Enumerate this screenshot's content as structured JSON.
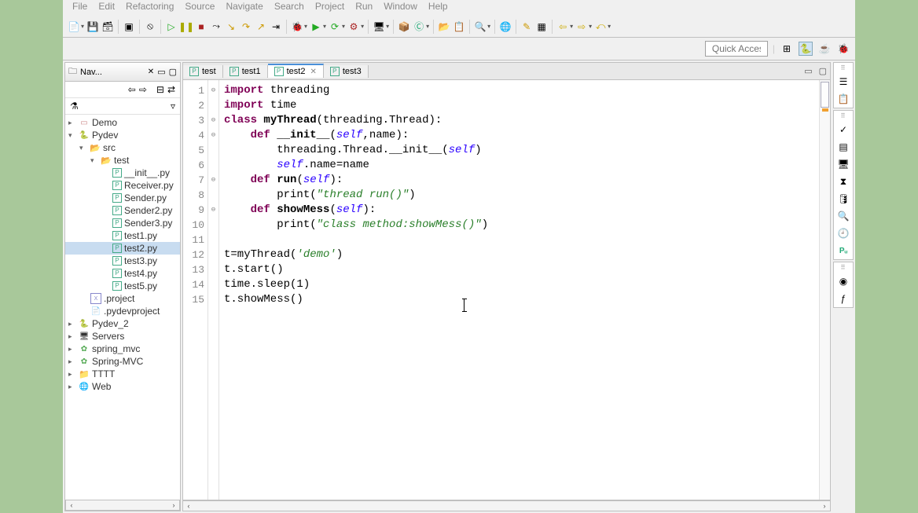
{
  "menu": [
    "File",
    "Edit",
    "Refactoring",
    "Source",
    "Navigate",
    "Search",
    "Project",
    "Run",
    "Window",
    "Help"
  ],
  "quick_access": {
    "placeholder": "Quick Access"
  },
  "nav": {
    "title": "Nav...",
    "tree": {
      "projects": [
        {
          "name": "Demo",
          "icon": "java-proj"
        },
        {
          "name": "Pydev",
          "icon": "py-proj",
          "expanded": true,
          "children": [
            {
              "name": "src",
              "icon": "folder-open",
              "expanded": true,
              "children": [
                {
                  "name": "test",
                  "icon": "folder-open",
                  "expanded": true,
                  "children": [
                    {
                      "name": "__init__.py",
                      "icon": "py"
                    },
                    {
                      "name": "Receiver.py",
                      "icon": "py"
                    },
                    {
                      "name": "Sender.py",
                      "icon": "py"
                    },
                    {
                      "name": "Sender2.py",
                      "icon": "py"
                    },
                    {
                      "name": "Sender3.py",
                      "icon": "py"
                    },
                    {
                      "name": "test1.py",
                      "icon": "py"
                    },
                    {
                      "name": "test2.py",
                      "icon": "py",
                      "selected": true
                    },
                    {
                      "name": "test3.py",
                      "icon": "py"
                    },
                    {
                      "name": "test4.py",
                      "icon": "py"
                    },
                    {
                      "name": "test5.py",
                      "icon": "py"
                    }
                  ]
                }
              ]
            },
            {
              "name": ".project",
              "icon": "xml"
            },
            {
              "name": ".pydevproject",
              "icon": "file"
            }
          ]
        },
        {
          "name": "Pydev_2",
          "icon": "py-proj"
        },
        {
          "name": "Servers",
          "icon": "server-proj"
        },
        {
          "name": "spring_mvc",
          "icon": "spring-proj"
        },
        {
          "name": "Spring-MVC",
          "icon": "spring-proj"
        },
        {
          "name": "TTTT",
          "icon": "folder"
        },
        {
          "name": "Web",
          "icon": "web-proj"
        }
      ]
    }
  },
  "editor": {
    "tabs": [
      {
        "label": "test",
        "icon": "py",
        "active": false
      },
      {
        "label": "test1",
        "icon": "py",
        "active": false
      },
      {
        "label": "test2",
        "icon": "py",
        "active": true
      },
      {
        "label": "test3",
        "icon": "py",
        "active": false
      }
    ],
    "code_lines": [
      {
        "n": 1,
        "fold": "⊖",
        "tokens": [
          {
            "t": "import ",
            "c": "kw"
          },
          {
            "t": "threading"
          }
        ]
      },
      {
        "n": 2,
        "fold": "",
        "tokens": [
          {
            "t": "import ",
            "c": "kw"
          },
          {
            "t": "time"
          }
        ]
      },
      {
        "n": 3,
        "fold": "⊖",
        "tokens": [
          {
            "t": "class ",
            "c": "kw"
          },
          {
            "t": "myThread",
            "c": "decl"
          },
          {
            "t": "(threading.Thread):"
          }
        ]
      },
      {
        "n": 4,
        "fold": "⊖",
        "tokens": [
          {
            "t": "    "
          },
          {
            "t": "def ",
            "c": "kw"
          },
          {
            "t": "__init__",
            "c": "fn"
          },
          {
            "t": "("
          },
          {
            "t": "self",
            "c": "self"
          },
          {
            "t": ",name):"
          }
        ]
      },
      {
        "n": 5,
        "fold": "",
        "tokens": [
          {
            "t": "        threading.Thread.__init__("
          },
          {
            "t": "self",
            "c": "self"
          },
          {
            "t": ")"
          }
        ]
      },
      {
        "n": 6,
        "fold": "",
        "tokens": [
          {
            "t": "        "
          },
          {
            "t": "self",
            "c": "self"
          },
          {
            "t": ".name=name"
          }
        ]
      },
      {
        "n": 7,
        "fold": "⊖",
        "tokens": [
          {
            "t": "    "
          },
          {
            "t": "def ",
            "c": "kw"
          },
          {
            "t": "run",
            "c": "fn"
          },
          {
            "t": "("
          },
          {
            "t": "self",
            "c": "self"
          },
          {
            "t": "):"
          }
        ]
      },
      {
        "n": 8,
        "fold": "",
        "tokens": [
          {
            "t": "        "
          },
          {
            "t": "print",
            "c": "builtin"
          },
          {
            "t": "("
          },
          {
            "t": "\"thread run()\"",
            "c": "str"
          },
          {
            "t": ")"
          }
        ]
      },
      {
        "n": 9,
        "fold": "⊖",
        "tokens": [
          {
            "t": "    "
          },
          {
            "t": "def ",
            "c": "kw"
          },
          {
            "t": "showMess",
            "c": "fn"
          },
          {
            "t": "("
          },
          {
            "t": "self",
            "c": "self"
          },
          {
            "t": "):"
          }
        ]
      },
      {
        "n": 10,
        "fold": "",
        "tokens": [
          {
            "t": "        "
          },
          {
            "t": "print",
            "c": "builtin"
          },
          {
            "t": "("
          },
          {
            "t": "\"class method:showMess()\"",
            "c": "str"
          },
          {
            "t": ")"
          }
        ]
      },
      {
        "n": 11,
        "fold": "",
        "tokens": []
      },
      {
        "n": 12,
        "fold": "",
        "tokens": [
          {
            "t": "t=myThread("
          },
          {
            "t": "'demo'",
            "c": "str"
          },
          {
            "t": ")"
          }
        ]
      },
      {
        "n": 13,
        "fold": "",
        "tokens": [
          {
            "t": "t.start()"
          }
        ]
      },
      {
        "n": 14,
        "fold": "",
        "tokens": [
          {
            "t": "time.sleep(1)"
          }
        ]
      },
      {
        "n": 15,
        "fold": "",
        "tokens": [
          {
            "t": "t.showMess()"
          }
        ]
      }
    ]
  },
  "right_strip": {
    "group1": [
      "outline-icon",
      "tasks-icon"
    ],
    "group2": [
      "task-list-icon",
      "console-icon",
      "servers-icon",
      "progress-icon",
      "data-source-icon",
      "search-icon",
      "history-icon",
      "pyunit-icon"
    ],
    "group3": [
      "breakpoints-icon",
      "expressions-icon"
    ]
  }
}
